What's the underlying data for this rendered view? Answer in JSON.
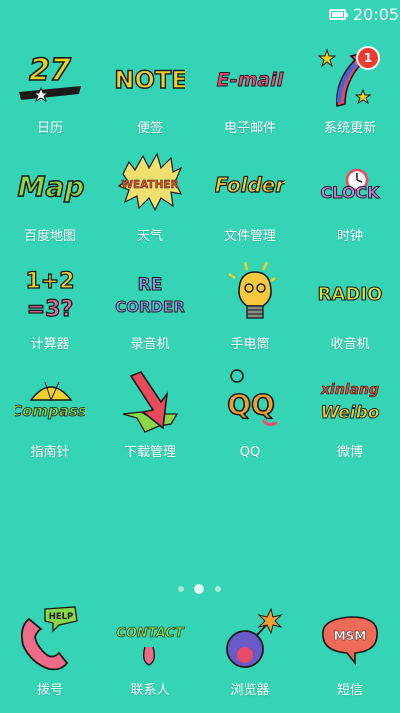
{
  "status_bar": {
    "time": "20:05"
  },
  "apps": [
    {
      "id": "calendar",
      "label": "日历",
      "icon_text": "27",
      "icon": "calendar-icon"
    },
    {
      "id": "notes",
      "label": "便签",
      "icon_text": "NOTE",
      "icon": "note-icon"
    },
    {
      "id": "email",
      "label": "电子邮件",
      "icon_text": "E-mail",
      "icon": "email-icon"
    },
    {
      "id": "update",
      "label": "系统更新",
      "icon": "update-icon",
      "badge": "1"
    },
    {
      "id": "map",
      "label": "百度地图",
      "icon_text": "Map",
      "icon": "map-icon"
    },
    {
      "id": "weather",
      "label": "天气",
      "icon_text": "WEATHER",
      "icon": "weather-icon"
    },
    {
      "id": "files",
      "label": "文件管理",
      "icon_text": "Folder",
      "icon": "folder-icon"
    },
    {
      "id": "clock",
      "label": "时钟",
      "icon_text": "CLOCK",
      "icon": "clock-icon"
    },
    {
      "id": "calculator",
      "label": "计算器",
      "icon_text_1": "1+2",
      "icon_text_2": "=3?",
      "icon": "calculator-icon"
    },
    {
      "id": "recorder",
      "label": "录音机",
      "icon_text_1": "RE",
      "icon_text_2": "CORDER",
      "icon": "recorder-icon"
    },
    {
      "id": "flashlight",
      "label": "手电筒",
      "icon": "flashlight-icon"
    },
    {
      "id": "radio",
      "label": "收音机",
      "icon_text": "RADIO",
      "icon": "radio-icon"
    },
    {
      "id": "compass",
      "label": "指南针",
      "icon_text": "Compass",
      "icon": "compass-icon"
    },
    {
      "id": "download",
      "label": "下载管理",
      "icon": "download-icon"
    },
    {
      "id": "qq",
      "label": "QQ",
      "icon_text": "QQ",
      "icon": "qq-icon"
    },
    {
      "id": "weibo",
      "label": "微博",
      "icon_text_1": "xinlang",
      "icon_text_2": "Weibo",
      "icon": "weibo-icon"
    }
  ],
  "page_indicator": {
    "pages": 3,
    "active": 2
  },
  "dock": [
    {
      "id": "dialer",
      "label": "拨号",
      "icon_text": "HELP",
      "icon": "phone-icon"
    },
    {
      "id": "contacts",
      "label": "联系人",
      "icon_text": "CONTACT",
      "icon": "contacts-icon"
    },
    {
      "id": "browser",
      "label": "浏览器",
      "icon": "bomb-icon"
    },
    {
      "id": "sms",
      "label": "短信",
      "icon_text": "MSM",
      "icon": "message-icon"
    }
  ],
  "colors": {
    "background": "#35d4b4",
    "badge": "#ee3a30",
    "label": "#ffffff"
  }
}
